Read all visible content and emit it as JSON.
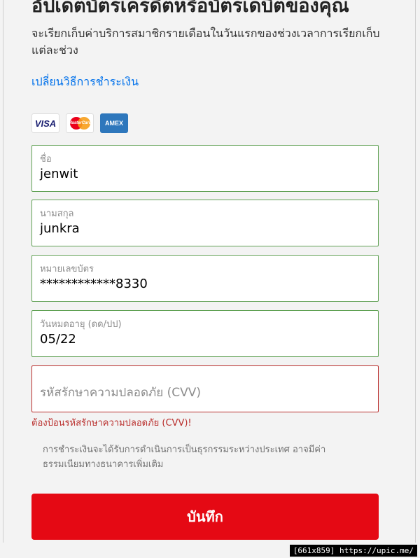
{
  "header": {
    "title": "อัปเดตบัตรเครดิตหรือบัตรเดบิตของคุณ",
    "subtitle": "จะเรียกเก็บค่าบริการสมาชิกรายเดือนในวันแรกของช่วงเวลาการเรียกเก็บแต่ละช่วง"
  },
  "change_payment_link": "เปลี่ยนวิธีการชำระเงิน",
  "card_logos": {
    "visa": "VISA",
    "mastercard": "MasterCard",
    "amex": "AMEX"
  },
  "form": {
    "first_name": {
      "label": "ชื่อ",
      "value": "jenwit"
    },
    "last_name": {
      "label": "นามสกุล",
      "value": "junkra"
    },
    "card_number": {
      "label": "หมายเลขบัตร",
      "value": "************8330"
    },
    "expiry": {
      "label": "วันหมดอายุ (ดด/ปป)",
      "value": "05/22"
    },
    "cvv": {
      "placeholder": "รหัสรักษาความปลอดภัย (CVV)",
      "value": ""
    },
    "cvv_error": "ต้องป้อนรหัสรักษาความปลอดภัย (CVV)!"
  },
  "note": "การชำระเงินจะได้รับการดำเนินการเป็นธุรกรรมระหว่างประเทศ อาจมีค่าธรรมเนียมทางธนาคารเพิ่มเติม",
  "save_button": "บันทึก",
  "watermark": "[661x859] https://upic.me/",
  "colors": {
    "accent_red": "#e50914",
    "link_blue": "#0071eb",
    "valid_border": "#5fa053",
    "error_red": "#b92d2b"
  }
}
